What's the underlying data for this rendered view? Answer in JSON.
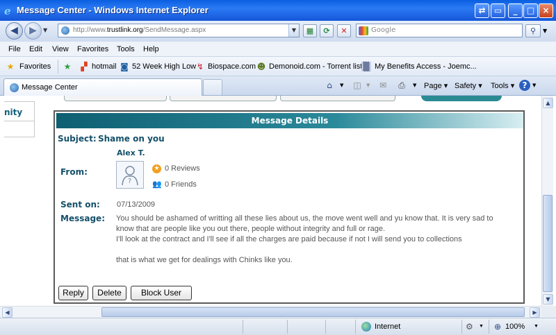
{
  "window": {
    "title": "Message Center - Windows Internet Explorer",
    "buttons": {
      "back_forward": "⇄",
      "restore": "▭",
      "minimize": "_",
      "maximize": "□",
      "close": "×"
    }
  },
  "address": {
    "url_prefix": "http://www.",
    "url_domain": "trustlink.org",
    "url_path": "/SendMessage.aspx",
    "search_placeholder": "Google"
  },
  "menu": [
    "File",
    "Edit",
    "View",
    "Favorites",
    "Tools",
    "Help"
  ],
  "favorites": {
    "label": "Favorites",
    "items": [
      "hotmail",
      "52 Week High Low",
      "Biospace.com",
      "Demonoid.com - Torrent list",
      "My Benefits Access - Joemc..."
    ]
  },
  "tabs": {
    "active": "Message Center"
  },
  "commandbar": {
    "page": "Page",
    "safety": "Safety",
    "tools": "Tools"
  },
  "leftnav": {
    "item": "nity"
  },
  "message": {
    "header": "Message Details",
    "subject_label": "Subject:",
    "subject": "Shame on you",
    "from_label": "From:",
    "sender_name": "Alex T.",
    "reviews": "0 Reviews",
    "friends": "0 Friends",
    "sent_label": "Sent on:",
    "sent_date": "07/13/2009",
    "message_label": "Message:",
    "body": [
      "You should be ashamed of writting all these lies about us, the move went well and yu know that. It is very sad to",
      "know that are people like you out there, people without integrity and full or rage.",
      "I'll look at the contract and I'll see if all the charges are paid because if not I will send you to collections",
      "",
      "that is what we get for dealings with Chinks like you."
    ],
    "buttons": {
      "reply": "Reply",
      "delete": "Delete",
      "block": "Block User"
    }
  },
  "status": {
    "zone": "Internet",
    "zoom": "100%"
  }
}
